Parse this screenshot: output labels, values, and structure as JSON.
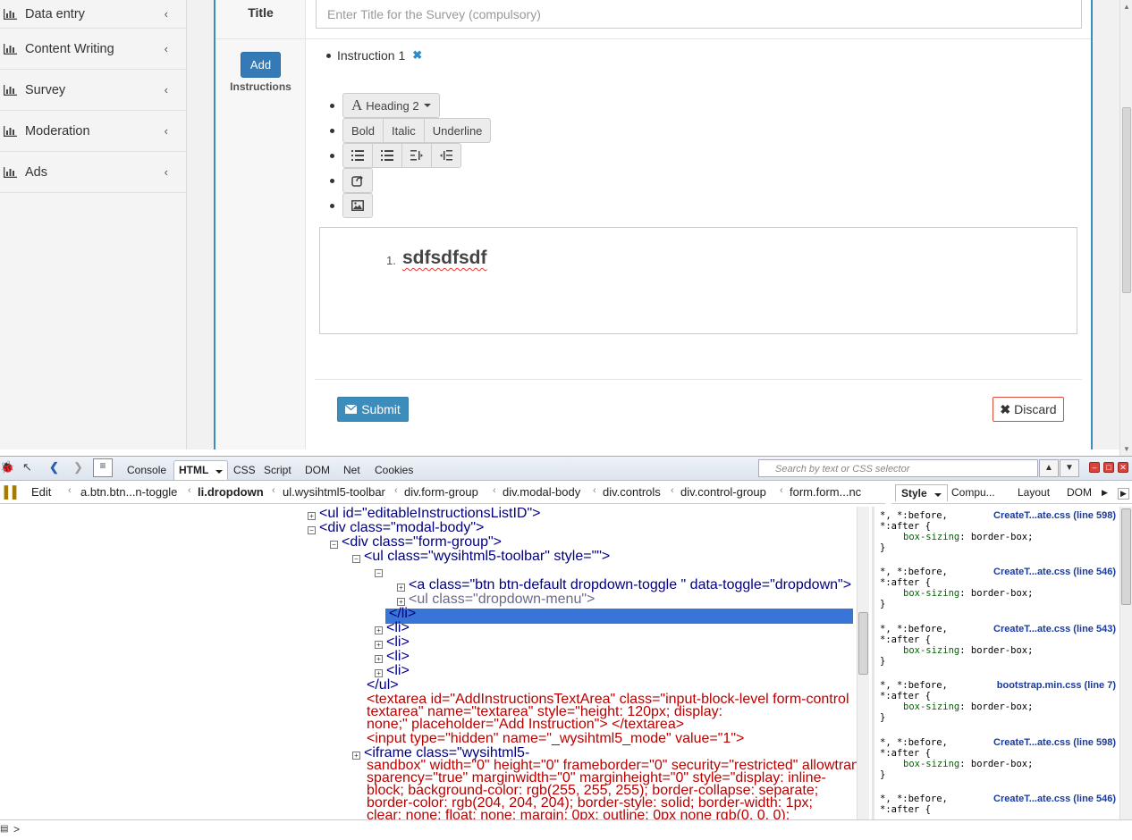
{
  "sidebar": {
    "items": [
      {
        "label": "Data entry"
      },
      {
        "label": "Content Writing"
      },
      {
        "label": "Survey"
      },
      {
        "label": "Moderation"
      },
      {
        "label": "Ads"
      }
    ]
  },
  "form": {
    "title_label": "Title",
    "title_placeholder": "Enter Title for the Survey (compulsory)",
    "add_button": "Add",
    "instructions_label": "Instructions",
    "instruction_item": "Instruction 1",
    "toolbar": {
      "heading": "Heading 2",
      "bold": "Bold",
      "italic": "Italic",
      "underline": "Underline"
    },
    "editor_number": "1.",
    "editor_text": "sdfsdfsdf",
    "submit": "Submit",
    "discard": "Discard"
  },
  "firebug": {
    "tabs": [
      "Console",
      "HTML",
      "CSS",
      "Script",
      "DOM",
      "Net",
      "Cookies"
    ],
    "active_tab": "HTML",
    "search_placeholder": "Search by text or CSS selector",
    "edit": "Edit",
    "breadcrumbs": [
      "a.btn.btn...n-toggle",
      "li.dropdown",
      "ul.wysihtml5-toolbar",
      "div.form-group",
      "div.modal-body",
      "div.controls",
      "div.control-group",
      "form.form...nc"
    ],
    "side_tabs": [
      "Style",
      "Compu...",
      "Layout",
      "DOM"
    ],
    "code_lines": [
      "<ul id=\"editableInstructionsListID\">",
      "<div class=\"modal-body\">",
      "<div class=\"form-group\">",
      "<ul class=\"wysihtml5-toolbar\" style=\"\">",
      "<li class=\"dropdown\">",
      "<a class=\"btn btn-default dropdown-toggle \" data-toggle=\"dropdown\">",
      "<ul class=\"dropdown-menu\">",
      "</li>",
      "<li>",
      "<li>",
      "<li>",
      "<li>",
      "</ul>",
      "<textarea id=\"AddInstructionsTextArea\" class=\"input-block-level form-control",
      "textarea\" name=\"textarea\" style=\"height: 120px; display:",
      "none;\" placeholder=\"Add Instruction\"> </textarea>",
      "<input type=\"hidden\" name=\"_wysihtml5_mode\" value=\"1\">",
      "<iframe class=\"wysihtml5-",
      "sandbox\" width=\"0\" height=\"0\" frameborder=\"0\" security=\"restricted\" allowtran",
      "sparency=\"true\" marginwidth=\"0\" marginheight=\"0\" style=\"display: inline-",
      "block; background-color: rgb(255, 255, 255); border-collapse: separate;",
      "border-color: rgb(204, 204, 204); border-style: solid; border-width: 1px;",
      "clear: none; float: none; margin: 0px; outline: 0px none rgb(0, 0, 0);"
    ],
    "style_rules": [
      {
        "selector1": "*, *:before,",
        "selector2": "*:after {",
        "source": "CreateT...ate.css (line 598)",
        "prop": "box-sizing",
        "value": "border-box;",
        "close": "}"
      },
      {
        "selector1": "*, *:before,",
        "selector2": "*:after {",
        "source": "CreateT...ate.css (line 546)",
        "prop": "box-sizing",
        "value": "border-box;",
        "close": "}"
      },
      {
        "selector1": "*, *:before,",
        "selector2": "*:after {",
        "source": "CreateT...ate.css (line 543)",
        "prop": "box-sizing",
        "value": "border-box;",
        "close": "}"
      },
      {
        "selector1": "*, *:before,",
        "selector2": "*:after {",
        "source": "bootstrap.min.css (line 7)",
        "prop": "box-sizing",
        "value": "border-box;",
        "close": "}"
      },
      {
        "selector1": "*, *:before,",
        "selector2": "*:after {",
        "source": "CreateT...ate.css (line 598)",
        "prop": "box-sizing",
        "value": "border-box;",
        "close": "}"
      },
      {
        "selector1": "*, *:before,",
        "selector2": "*:after {",
        "source": "CreateT...ate.css (line 546)",
        "prop": "",
        "value": "",
        "close": ""
      }
    ],
    "cmd_prompt": ">"
  }
}
